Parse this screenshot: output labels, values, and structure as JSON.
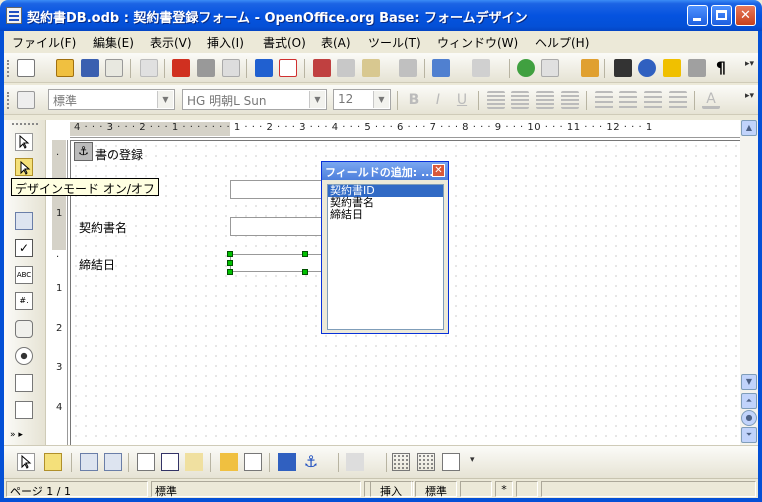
{
  "window": {
    "title": "契約書DB.odb : 契約書登録フォーム - OpenOffice.org Base: フォームデザイン"
  },
  "menu": [
    "ファイル(F)",
    "編集(E)",
    "表示(V)",
    "挿入(I)",
    "書式(O)",
    "表(A)",
    "ツール(T)",
    "ウィンドウ(W)",
    "ヘルプ(H)"
  ],
  "formatting": {
    "style": "標準",
    "font": "HG 明朝L Sun",
    "size": "12"
  },
  "ruler": {
    "horizontal": "4 · · · 3 · · · 2 · · · 1 · · · · · · · 1 · · · 2 · · · 3 · · · 4 · · · 5 · · · 6 · · · 7 · · · 8 · · · 9 · · · 10 · · · 11 · · · 12 · · · 1",
    "vertical": [
      "·",
      "1",
      "·",
      "1",
      "2",
      "3",
      "4"
    ]
  },
  "form": {
    "title_label": "書の登録",
    "field1_label": "契約書名",
    "field2_label": "締結日"
  },
  "tooltip": "デザインモード オン/オフ",
  "add_field_dialog": {
    "title": "フィールドの追加: ...",
    "fields": [
      "契約書ID",
      "契約書名",
      "締結日"
    ],
    "selected": "契約書ID"
  },
  "status": {
    "page": "ページ 1 / 1",
    "style": "標準",
    "insert_mode": "挿入",
    "selection_mode": "標準",
    "modified": "*"
  },
  "colors": {
    "titlebar": "#0553e0",
    "selection": "#316ac5",
    "handle": "#00c000"
  }
}
